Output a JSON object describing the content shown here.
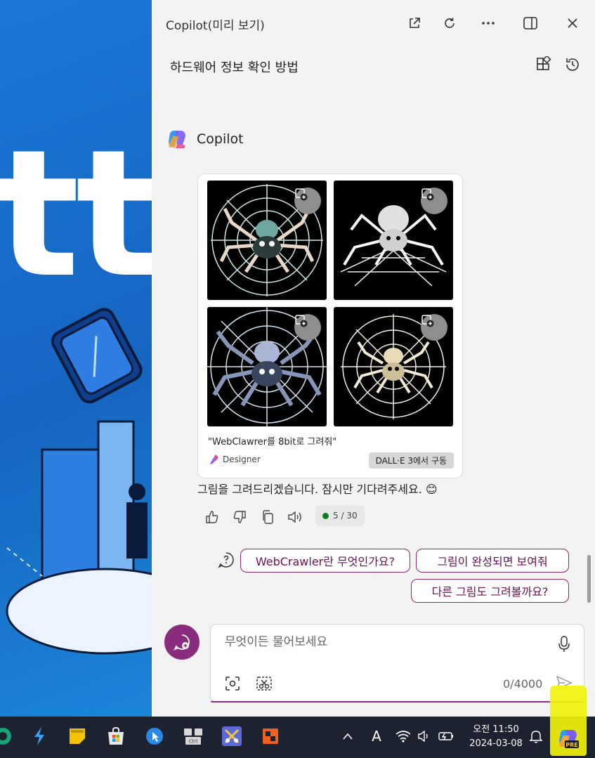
{
  "window": {
    "title": "Copilot(미리 보기)",
    "conversation_title": "하드웨어 정보 확인 방법"
  },
  "assistant": {
    "name": "Copilot"
  },
  "image_card": {
    "prompt": "\"WebClawrer를 8bit로 그려줘\"",
    "designer_label": "Designer",
    "badge": "DALL·E 3에서 구동"
  },
  "message": {
    "text": "그림을 그려드리겠습니다. 잠시만 기다려주세요. 😊",
    "counter": "5 / 30"
  },
  "suggestions": [
    "WebCrawler란 무엇인가요?",
    "그림이 완성되면 보여줘",
    "다른 그림도 그려볼까요?"
  ],
  "composer": {
    "placeholder": "무엇이든 물어보세요",
    "char_count": "0/4000"
  },
  "taskbar": {
    "time": "오전 11:50",
    "date": "2024-03-08",
    "input_indicator": "A",
    "copilot_badge": "PRE"
  },
  "colors": {
    "accent": "#8a2c7d",
    "panel_bg": "#f3f3f3",
    "desktop_bg": "#1565c0",
    "taskbar_bg": "#1c2230",
    "highlight": "#f2f20c"
  }
}
